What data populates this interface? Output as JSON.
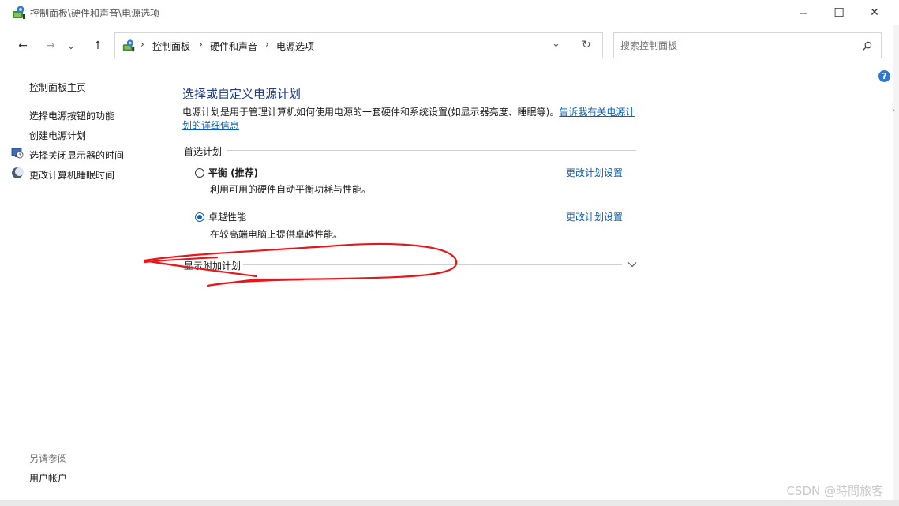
{
  "window": {
    "title": "控制面板\\硬件和声音\\电源选项",
    "minimize_glyph": "—",
    "maximize_glyph": "☐",
    "close_glyph": "✕"
  },
  "nav": {
    "back_glyph": "←",
    "forward_glyph": "→",
    "history_glyph": "⌄",
    "up_glyph": "↑",
    "breadcrumbs": [
      "控制面板",
      "硬件和声音",
      "电源选项"
    ],
    "separator": "›",
    "dropdown_glyph": "⌄",
    "refresh_glyph": "↻"
  },
  "search": {
    "placeholder": "搜索控制面板",
    "value": ""
  },
  "sidebar": {
    "home": "控制面板主页",
    "items": [
      {
        "label": "选择电源按钮的功能",
        "icon": "none"
      },
      {
        "label": "创建电源计划",
        "icon": "none"
      },
      {
        "label": "选择关闭显示器的时间",
        "icon": "monitor-clock-icon"
      },
      {
        "label": "更改计算机睡眠时间",
        "icon": "moon-icon"
      }
    ],
    "see_also": "另请参阅",
    "see_also_items": [
      "用户帐户"
    ]
  },
  "main": {
    "title": "选择或自定义电源计划",
    "description": "电源计划是用于管理计算机如何使用电源的一套硬件和系统设置(如显示器亮度、睡眠等)。",
    "description_link": "告诉我有关电源计划的详细信息",
    "preferred_section": "首选计划",
    "plans": [
      {
        "name": "平衡 (推荐)",
        "desc": "利用可用的硬件自动平衡功耗与性能。",
        "link": "更改计划设置",
        "selected": false
      },
      {
        "name": "卓越性能",
        "desc": "在较高端电脑上提供卓越性能。",
        "link": "更改计划设置",
        "selected": true
      }
    ],
    "more_plans": "显示附加计划"
  },
  "help_glyph": "?",
  "watermark": "CSDN @時間旅客",
  "colors": {
    "accent": "#0b5fb3",
    "title_blue": "#1e3c8c",
    "annotation_red": "#e8161b"
  }
}
